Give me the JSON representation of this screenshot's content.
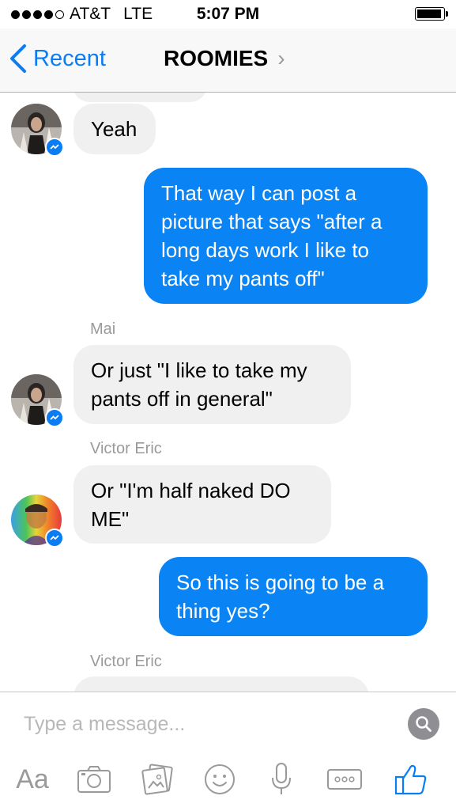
{
  "status_bar": {
    "carrier": "AT&T",
    "network": "LTE",
    "time": "5:07 PM",
    "signal_dots_filled": 4,
    "signal_dots_total": 5
  },
  "nav": {
    "back_label": "Recent",
    "title": "ROOMIES",
    "title_chevron": "›"
  },
  "messages": [
    {
      "type": "in",
      "text": "Yeah"
    },
    {
      "type": "out",
      "text": "That way I can post a picture that says \"after a long days work I like to take my pants off\""
    },
    {
      "type": "in",
      "sender": "Mai",
      "text": "Or just \"I like to take my pants off in general\""
    },
    {
      "type": "in",
      "sender": "Victor Eric",
      "text": "Or \"I'm half naked DO ME\""
    },
    {
      "type": "out",
      "text": "So this is going to be a thing yes?"
    },
    {
      "type": "in",
      "sender": "Victor Eric",
      "text": ""
    }
  ],
  "composer": {
    "placeholder": "Type a message...",
    "text_format_label": "Aa"
  },
  "icons": [
    "back-chevron-icon",
    "messenger-badge-icon",
    "search-icon",
    "camera-icon",
    "photo-gallery-icon",
    "emoji-icon",
    "microphone-icon",
    "more-icon",
    "thumbs-up-icon"
  ],
  "colors": {
    "accent": "#0a7cf4",
    "outgoing_bubble": "#0a84f4",
    "incoming_bubble": "#f1f0f0",
    "muted": "#9a9a9a"
  }
}
